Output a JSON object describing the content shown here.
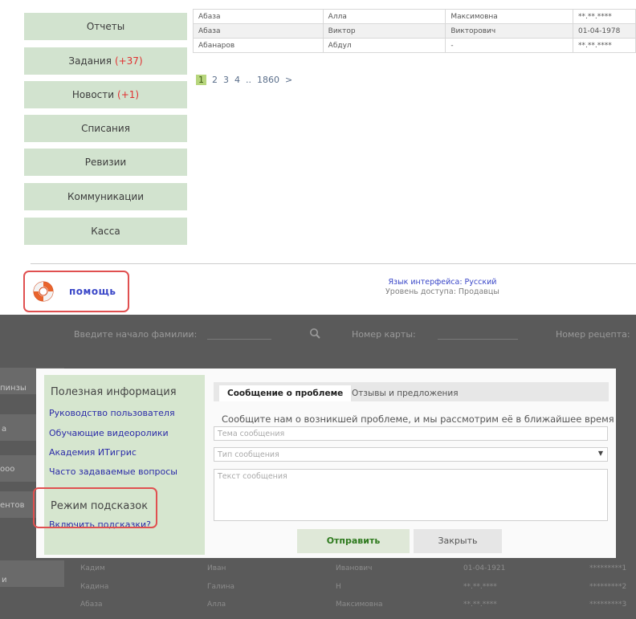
{
  "nav": [
    {
      "label": "Отчеты",
      "badge": ""
    },
    {
      "label": "Задания",
      "badge": "(+37)"
    },
    {
      "label": "Новости",
      "badge": "(+1)"
    },
    {
      "label": "Списания",
      "badge": ""
    },
    {
      "label": "Ревизии",
      "badge": ""
    },
    {
      "label": "Коммуникации",
      "badge": ""
    },
    {
      "label": "Касса",
      "badge": ""
    }
  ],
  "top_table": {
    "rows": [
      [
        "Абаза",
        "Алла",
        "Максимовна",
        "**.**.****"
      ],
      [
        "Абаза",
        "Виктор",
        "Викторович",
        "01-04-1978"
      ],
      [
        "Абанаров",
        "Абдул",
        "-",
        "**.**.****"
      ]
    ]
  },
  "pager": {
    "current": "1",
    "pages": [
      "2",
      "3",
      "4"
    ],
    "ellipsis": "..",
    "last": "1860",
    "next": ">"
  },
  "help": {
    "label": "помощь"
  },
  "interface": {
    "language": "Язык интерфейса: Русский",
    "access_level": "Уровень доступа: Продавцы"
  },
  "background_screen": {
    "surname_prompt": "Введите начало фамилии:",
    "card_label": "Номер карты:",
    "recipe_label": "Номер рецепта:",
    "ghost_rows": [
      [
        "Кадим",
        "Иван",
        "Иванович",
        "01-04-1921",
        "*********1"
      ],
      [
        "Кадина",
        "Галина",
        "Н",
        "**.**.****",
        "*********2"
      ],
      [
        "Абаза",
        "Алла",
        "Максимовна",
        "**.**.****",
        "*********3"
      ]
    ],
    "left_fragments": [
      "пинзы",
      "а",
      "ооо",
      "ентов",
      "и"
    ]
  },
  "modal": {
    "info_title": "Полезная информация",
    "links": [
      "Руководство пользователя",
      "Обучающие видеоролики",
      "Академия ИТигрис",
      "Часто задаваемые вопросы"
    ],
    "hints_title": "Режим подсказок",
    "hints_link": "Включить подсказки?",
    "tab_active": "Сообщение о проблеме",
    "tab_other": "Отзывы и предложения",
    "description": "Сообщите нам о возникшей проблеме, и мы рассмотрим её в ближайшее время",
    "subject_placeholder": "Тема сообщения",
    "type_placeholder": "Тип сообщения",
    "text_placeholder": "Текст сообщения",
    "send_label": "Отправить",
    "close_label": "Закрыть"
  },
  "colors": {
    "accent_green": "#d2e3cf",
    "highlight_red": "#e05050",
    "link_blue": "#2b2ba8"
  }
}
